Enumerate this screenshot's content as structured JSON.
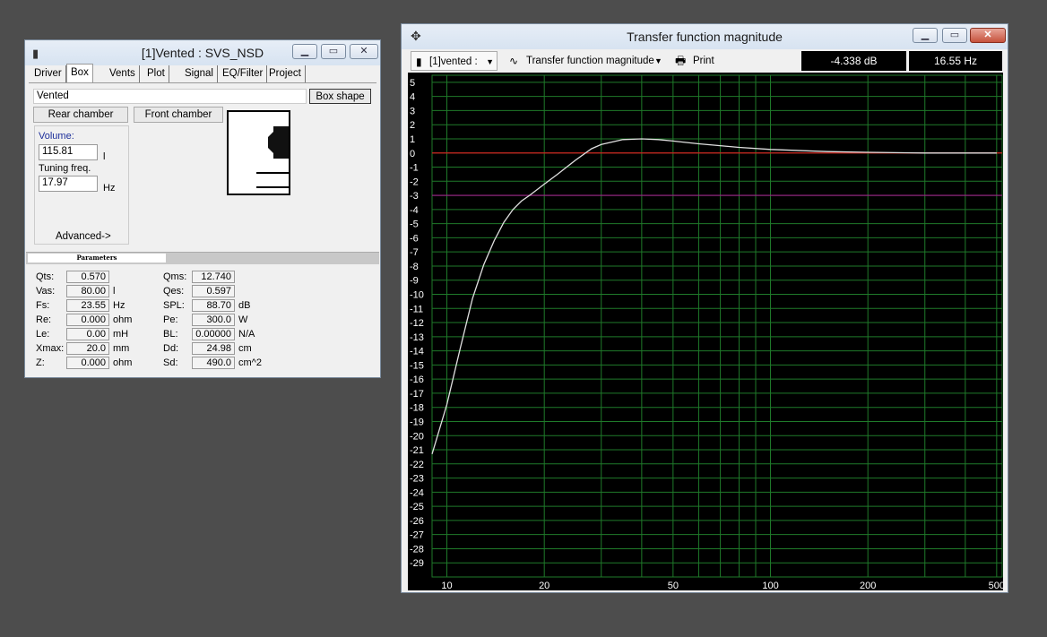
{
  "driver_window": {
    "title": "[1]Vented : SVS_NSD",
    "tabs": [
      "Driver",
      "Box",
      "Vents",
      "Plot",
      "Signal",
      "EQ/Filter",
      "Project"
    ],
    "active_tab": "Box",
    "box_type": "Vented",
    "box_shape_button": "Box shape",
    "rear_chamber_button": "Rear chamber",
    "front_chamber_button": "Front chamber",
    "volume_label": "Volume:",
    "volume_value": "115.81",
    "volume_unit": "l",
    "tuning_label": "Tuning freq.",
    "tuning_value": "17.97",
    "tuning_unit": "Hz",
    "advanced_button": "Advanced->",
    "parameters_header": "Parameters",
    "parameters_left": [
      {
        "label": "Qts:",
        "value": "0.570",
        "unit": ""
      },
      {
        "label": "Vas:",
        "value": "80.00",
        "unit": "l"
      },
      {
        "label": "Fs:",
        "value": "23.55",
        "unit": "Hz"
      },
      {
        "label": "Re:",
        "value": "0.000",
        "unit": "ohm"
      },
      {
        "label": "Le:",
        "value": "0.00",
        "unit": "mH"
      },
      {
        "label": "Xmax:",
        "value": "20.0",
        "unit": "mm"
      },
      {
        "label": "Z:",
        "value": "0.000",
        "unit": "ohm"
      }
    ],
    "parameters_right": [
      {
        "label": "Qms:",
        "value": "12.740",
        "unit": ""
      },
      {
        "label": "Qes:",
        "value": "0.597",
        "unit": ""
      },
      {
        "label": "SPL:",
        "value": "88.70",
        "unit": "dB"
      },
      {
        "label": "Pe:",
        "value": "300.0",
        "unit": "W"
      },
      {
        "label": "BL:",
        "value": "0.00000",
        "unit": "N/A"
      },
      {
        "label": "Dd:",
        "value": "24.98",
        "unit": "cm"
      },
      {
        "label": "Sd:",
        "value": "490.0",
        "unit": "cm^2"
      }
    ]
  },
  "plot_window": {
    "title": "Transfer function magnitude",
    "project_select": "[1]vented :",
    "plot_select": "Transfer function magnitude",
    "print_button": "Print",
    "readout_db": "-4.338 dB",
    "readout_hz": "16.55 Hz"
  },
  "chart_data": {
    "type": "line",
    "title": "",
    "xlabel": "",
    "ylabel": "",
    "x_scale": "log",
    "xlim": [
      9,
      520
    ],
    "ylim": [
      -30,
      5.5
    ],
    "x_tick_labels": [
      {
        "value": 10,
        "label": "10"
      },
      {
        "value": 20,
        "label": "20"
      },
      {
        "value": 50,
        "label": "50"
      },
      {
        "value": 100,
        "label": "100"
      },
      {
        "value": 200,
        "label": "200"
      },
      {
        "value": 500,
        "label": "500"
      }
    ],
    "y_ticks": [
      5,
      4,
      3,
      2,
      1,
      0,
      -1,
      -2,
      -3,
      -4,
      -5,
      -6,
      -7,
      -8,
      -9,
      -10,
      -11,
      -12,
      -13,
      -14,
      -15,
      -16,
      -17,
      -18,
      -19,
      -20,
      -21,
      -22,
      -23,
      -24,
      -25,
      -26,
      -27,
      -28,
      -29
    ],
    "grid": true,
    "background": "#000000",
    "grid_color": "#1f7a2a",
    "reference_lines": [
      {
        "y": 0,
        "color": "#d02020"
      },
      {
        "y": -3,
        "color": "#a0208a"
      }
    ],
    "series": [
      {
        "color": "#e0e0e0",
        "x": [
          9,
          10,
          11,
          12,
          13,
          14,
          15,
          16,
          17,
          18,
          20,
          22,
          25,
          28,
          30,
          35,
          40,
          45,
          50,
          60,
          80,
          100,
          150,
          200,
          300,
          500
        ],
        "y": [
          -21.3,
          -17.8,
          -13.8,
          -10.3,
          -7.9,
          -6.2,
          -4.9,
          -4.0,
          -3.4,
          -3.0,
          -2.2,
          -1.5,
          -0.5,
          0.3,
          0.6,
          0.95,
          1.0,
          0.95,
          0.85,
          0.65,
          0.4,
          0.25,
          0.1,
          0.05,
          0.0,
          0.0
        ]
      }
    ]
  }
}
